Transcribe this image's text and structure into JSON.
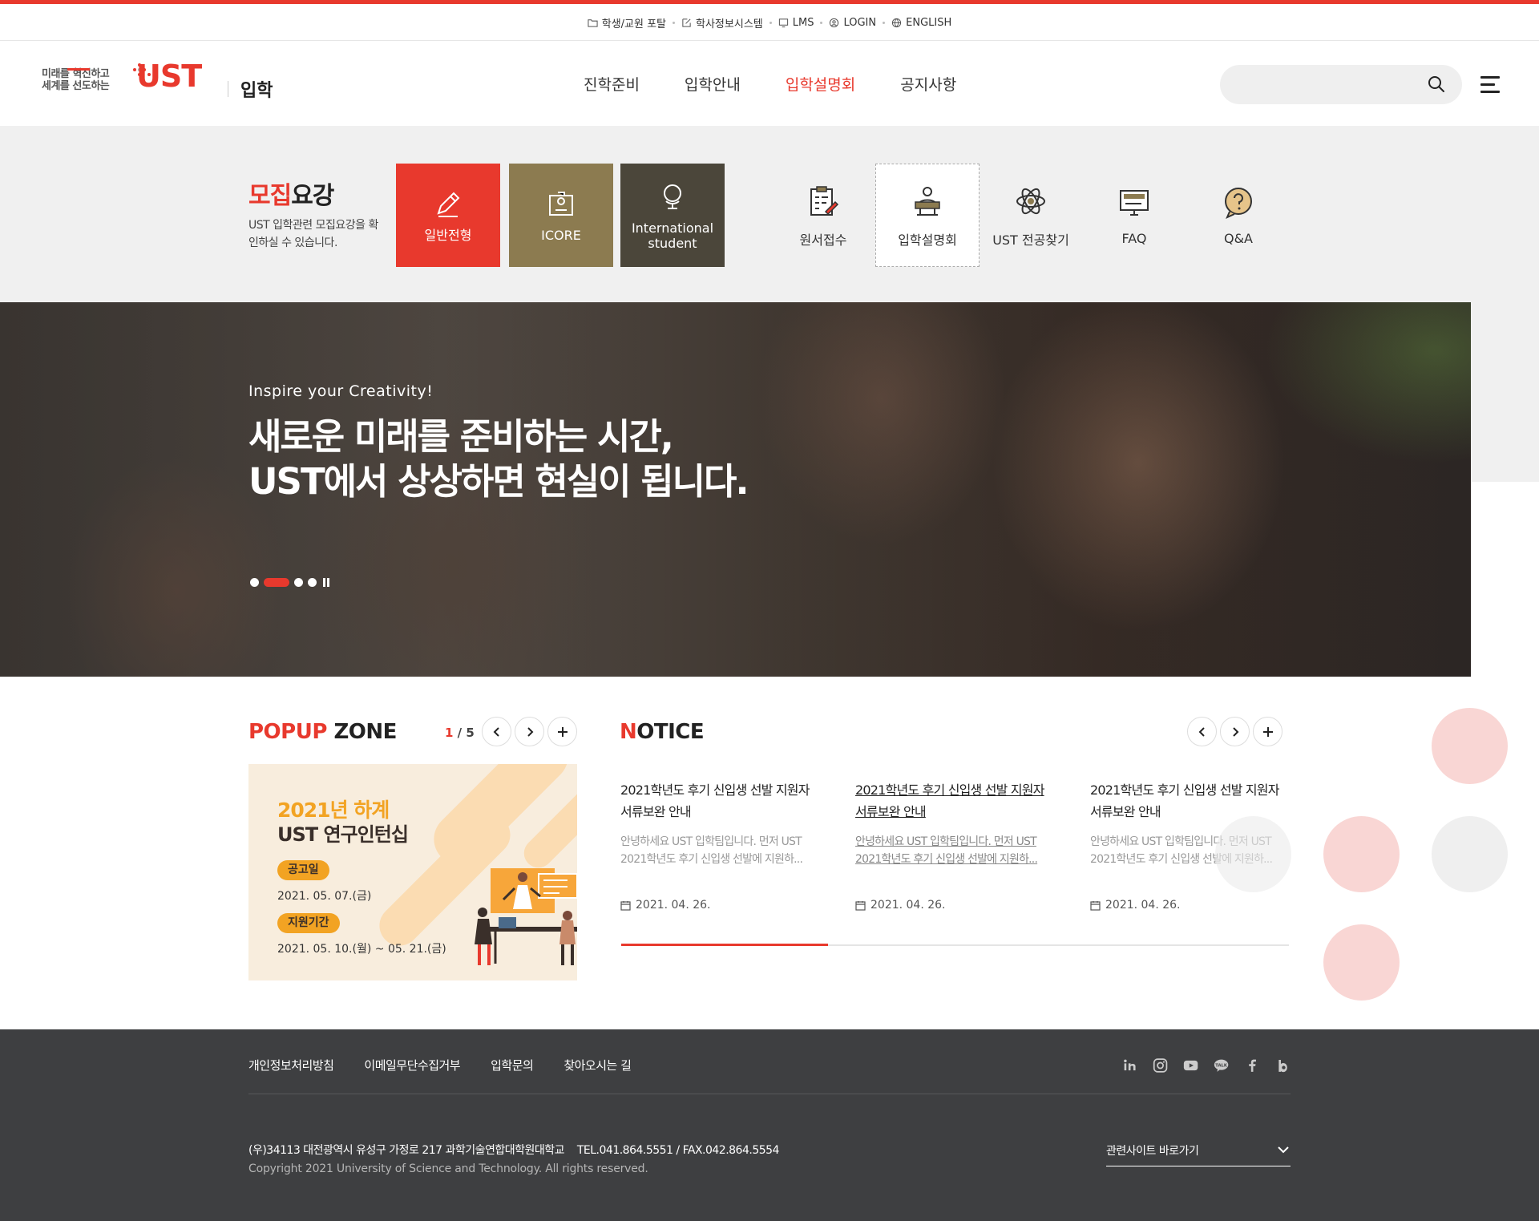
{
  "utility": {
    "items": [
      {
        "label": "학생/교원 포탈",
        "icon": "folder-icon"
      },
      {
        "label": "학사정보시스템",
        "icon": "edit-icon"
      },
      {
        "label": "LMS",
        "icon": "monitor-icon"
      },
      {
        "label": "LOGIN",
        "icon": "user-icon"
      },
      {
        "label": "ENGLISH",
        "icon": "globe-icon"
      }
    ]
  },
  "header": {
    "logo_slogan_line1": "미래를 혁신하고",
    "logo_slogan_line2": "세계를 선도하는",
    "logo_mark": "UST",
    "logo_sub": "입학",
    "nav": [
      {
        "label": "진학준비",
        "active": false
      },
      {
        "label": "입학안내",
        "active": false
      },
      {
        "label": "입학설명회",
        "active": true
      },
      {
        "label": "공지사항",
        "active": false
      }
    ],
    "search_placeholder": ""
  },
  "recruit": {
    "title_red": "모집",
    "title_black": "요강",
    "desc": "UST 입학관련 모집요강을 확인하실 수 있습니다.",
    "boxes": [
      {
        "label": "일반전형",
        "icon": "pencil-icon",
        "color": "#e8392d"
      },
      {
        "label": "ICORE",
        "icon": "certificate-icon",
        "color": "#8c7b50"
      },
      {
        "label": "International student",
        "icon": "globe-stand-icon",
        "color": "#4b463a"
      }
    ],
    "quick_links": [
      {
        "label": "원서접수",
        "icon": "clipboard-icon"
      },
      {
        "label": "입학설명회",
        "icon": "presenter-icon",
        "selected": true
      },
      {
        "label": "UST 전공찾기",
        "icon": "atom-icon"
      },
      {
        "label": "FAQ",
        "icon": "screen-icon"
      },
      {
        "label": "Q&A",
        "icon": "question-bubble-icon"
      }
    ]
  },
  "hero": {
    "eyebrow": "Inspire your Creativity!",
    "title_line1": "새로운 미래를 준비하는 시간,",
    "title_line2": "UST에서 상상하면 현실이 됩니다.",
    "slides": 4,
    "active_slide": 2
  },
  "popup": {
    "title_red": "POPUP",
    "title_black": " ZONE",
    "current": "1",
    "total": "5",
    "card": {
      "year": "2021년 하계",
      "name": "UST 연구인턴십",
      "badge1": "공고일",
      "date1": "2021. 05. 07.(금)",
      "badge2": "지원기간",
      "date2": "2021. 05. 10.(월) ~ 05. 21.(금)"
    }
  },
  "notice": {
    "title_red": "N",
    "title_black": "OTICE",
    "items": [
      {
        "title": "2021학년도 후기 신입생 선발 지원자 서류보완 안내",
        "desc": "안녕하세요 UST 입학팀입니다. 먼저 UST 2021학년도 후기 신입생 선발에 지원하...",
        "date": "2021. 04. 26."
      },
      {
        "title": "2021학년도 후기 신입생 선발 지원자 서류보완 안내",
        "desc": "안녕하세요 UST 입학팀입니다. 먼저 UST 2021학년도 후기 신입생 선발에 지원하...",
        "date": "2021. 04. 26."
      },
      {
        "title": "2021학년도 후기 신입생 선발 지원자 서류보완 안내",
        "desc": "안녕하세요 UST 입학팀입니다. 먼저 UST 2021학년도 후기 신입생 선발에 지원하...",
        "date": "2021. 04. 26."
      }
    ],
    "progress": 0.31
  },
  "footer": {
    "links": [
      "개인정보처리방침",
      "이메일무단수집거부",
      "입학문의",
      "찾아오시는 길"
    ],
    "sns": [
      "linkedin-icon",
      "instagram-icon",
      "youtube-icon",
      "kakaotalk-icon",
      "facebook-icon",
      "blog-icon"
    ],
    "address": "(우)34113 대전광역시 유성구 가정로 217 과학기술연합대학원대학교    TEL.041.864.5551 / FAX.042.864.5554",
    "copyright": "Copyright 2021 University of Science and Technology. All rights reserved.",
    "family_site": "관련사이트 바로가기"
  },
  "colors": {
    "accent": "#e8392d",
    "gold": "#8c7b50",
    "dark_olive": "#4b463a",
    "footer_bg": "#3e3f41",
    "popup_orange": "#f2a323"
  }
}
